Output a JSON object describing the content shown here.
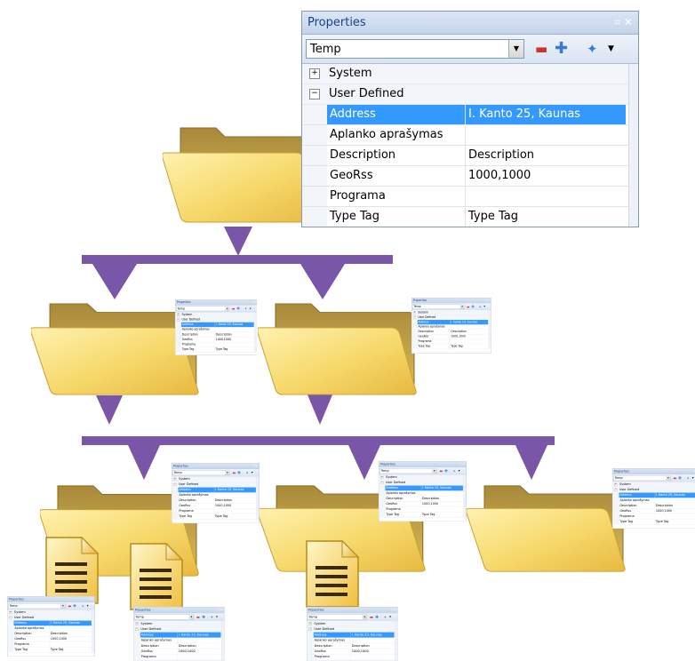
{
  "colors": {
    "arrow": "#7a56a8",
    "selection": "#3399ff",
    "folder_front": "#f5d565",
    "folder_back": "#b89a3a"
  },
  "properties_panel": {
    "title": "Properties",
    "pin_icon": "pin-icon",
    "close_icon": "close-icon",
    "combo_value": "Temp",
    "toolbar_icons": [
      "minus-icon",
      "plus-icon",
      "wand-icon"
    ],
    "categories": [
      {
        "label": "System",
        "expanded": false,
        "toggle": "⊞"
      },
      {
        "label": "User Defined",
        "expanded": true,
        "toggle": "⊟"
      }
    ],
    "rows": [
      {
        "key": "Address",
        "value": "I. Kanto 25, Kaunas",
        "selected": true
      },
      {
        "key": "Aplanko aprašymas",
        "value": "",
        "selected": false
      },
      {
        "key": "Description",
        "value": "Description",
        "selected": false
      },
      {
        "key": "GeoRss",
        "value": "1000,1000",
        "selected": false
      },
      {
        "key": "Programa",
        "value": "",
        "selected": false
      },
      {
        "key": "Type Tag",
        "value": "Type Tag",
        "selected": false
      }
    ]
  }
}
